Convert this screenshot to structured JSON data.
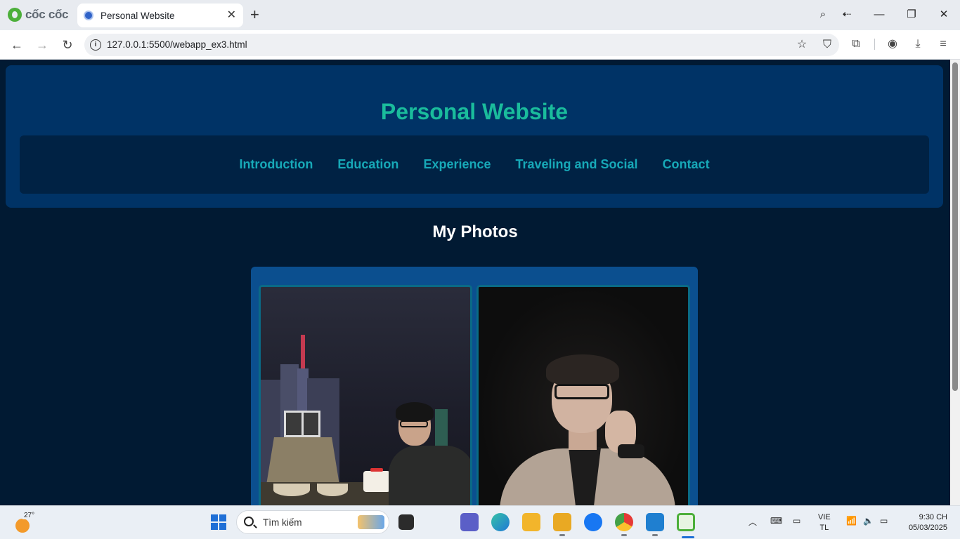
{
  "browser": {
    "brand": "cốc cốc",
    "tab_title": "Personal Website",
    "url": "127.0.0.1:5500/webapp_ex3.html"
  },
  "site": {
    "title": "Personal Website",
    "nav": [
      "Introduction",
      "Education",
      "Experience",
      "Traveling and Social",
      "Contact"
    ],
    "section_title": "My Photos",
    "colors": {
      "page_bg": "#011a33",
      "header_bg": "#003366",
      "nav_bg": "#002244",
      "title": "#1abc9c",
      "nav_link": "#17a9b8",
      "gallery_bg": "#0b4f8f"
    }
  },
  "taskbar": {
    "weather_temp": "27°",
    "search_placeholder": "Tìm kiếm",
    "language": "VIE",
    "language_sub": "TL",
    "time": "9:30 CH",
    "date": "05/03/2025"
  }
}
